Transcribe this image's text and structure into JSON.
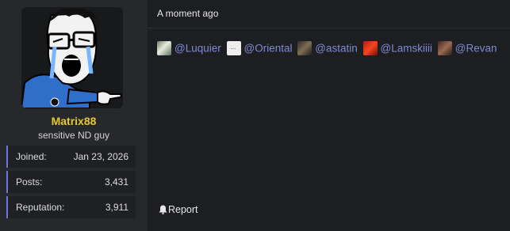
{
  "user": {
    "name": "Matrix88",
    "title": "sensitive ND guy",
    "name_color": "#e5c82b",
    "avatar_icon": "crying-wojak-pointing-avatar",
    "stats": [
      {
        "label": "Joined:",
        "value": "Jan 23, 2026"
      },
      {
        "label": "Posts:",
        "value": "3,431"
      },
      {
        "label": "Reputation:",
        "value": "3,911"
      }
    ]
  },
  "post": {
    "date": "A moment ago",
    "mentions": [
      {
        "name": "@Luquier"
      },
      {
        "name": "@Oriental"
      },
      {
        "name": "@astatin"
      },
      {
        "name": "@Lamskiiii"
      },
      {
        "name": "@Revan"
      }
    ],
    "mention_color": "#7e8ad1",
    "actions": {
      "report_label": "Report",
      "report_icon": "bell-icon"
    }
  }
}
